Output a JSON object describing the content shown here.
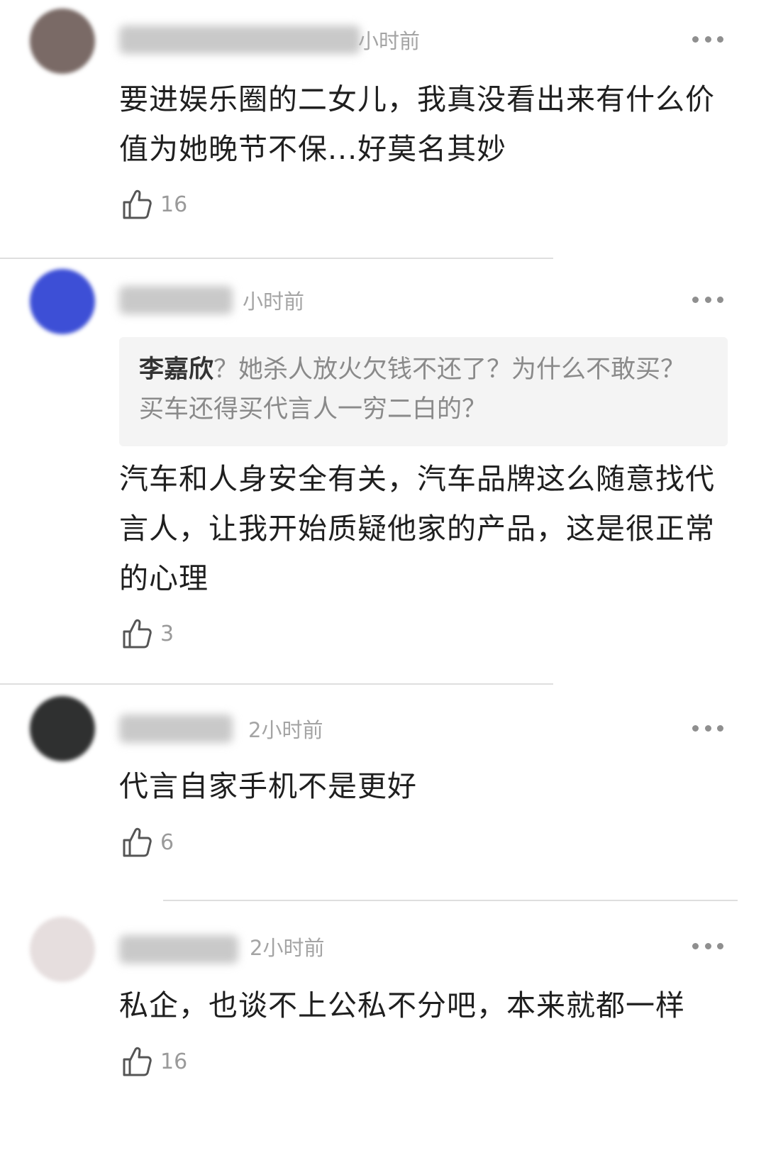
{
  "comments": [
    {
      "time": "小时前",
      "avatar_color": "#7a6a66",
      "text": "要进娱乐圈的二女儿，我真没看出来有什么价值为她晚节不保...好莫名其妙",
      "likes": "16"
    },
    {
      "time": "小时前",
      "avatar_color": "#3d4fd6",
      "quote_author": "李嘉欣",
      "quote_text": "？她杀人放火欠钱不还了？为什么不敢买？买车还得买代言人一穷二白的？",
      "text": "汽车和人身安全有关，汽车品牌这么随意找代言人，让我开始质疑他家的产品，这是很正常的心理",
      "likes": "3"
    },
    {
      "time": "2小时前",
      "avatar_color": "#2f3030",
      "text": "代言自家手机不是更好",
      "likes": "6"
    },
    {
      "time": "2小时前",
      "avatar_color": "#e6dede",
      "text": "私企，也谈不上公私不分吧，本来就都一样",
      "likes": "16"
    }
  ],
  "icons": {
    "like": "thumbs-up-icon",
    "more": "more-dots-icon"
  }
}
